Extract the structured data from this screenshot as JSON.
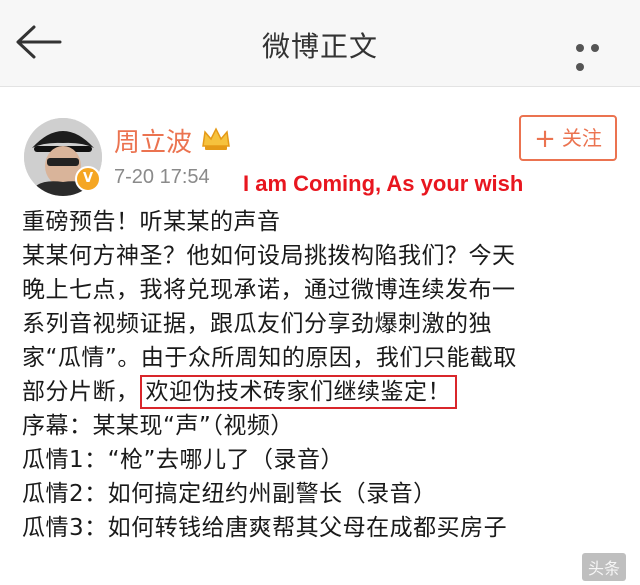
{
  "header": {
    "title": "微博正文"
  },
  "post": {
    "username": "周立波",
    "timestamp": "7-20 17:54",
    "follow_label": "关注",
    "overlay_caption": "I am Coming, As your wish",
    "lines": [
      "重磅预告！听某某的声音",
      "某某何方神圣？他如何设局挑拨构陷我们？今天",
      "晚上七点，我将兑现承诺，通过微博连续发布一",
      "系列音视频证据，跟瓜友们分享劲爆刺激的独",
      "家“瓜情”。由于众所周知的原因，我们只能截取"
    ],
    "line6_prefix": "部分片断，",
    "line6_highlight": "欢迎伪技术砖家们继续鉴定！",
    "lines_after": [
      "序幕：某某现“声”（视频）",
      "瓜情1：“枪”去哪儿了（录音）",
      "瓜情2：如何搞定纽约州副警长（录音）",
      "瓜情3：如何转钱给唐爽帮其父母在成都买房子"
    ],
    "watermark": "头条"
  },
  "colors": {
    "accent": "#eb7350",
    "highlight": "#d9262b",
    "caption": "#e8161f"
  },
  "icons": {
    "back": "back-arrow-icon",
    "more": "more-dots-icon",
    "crown": "crown-icon"
  }
}
